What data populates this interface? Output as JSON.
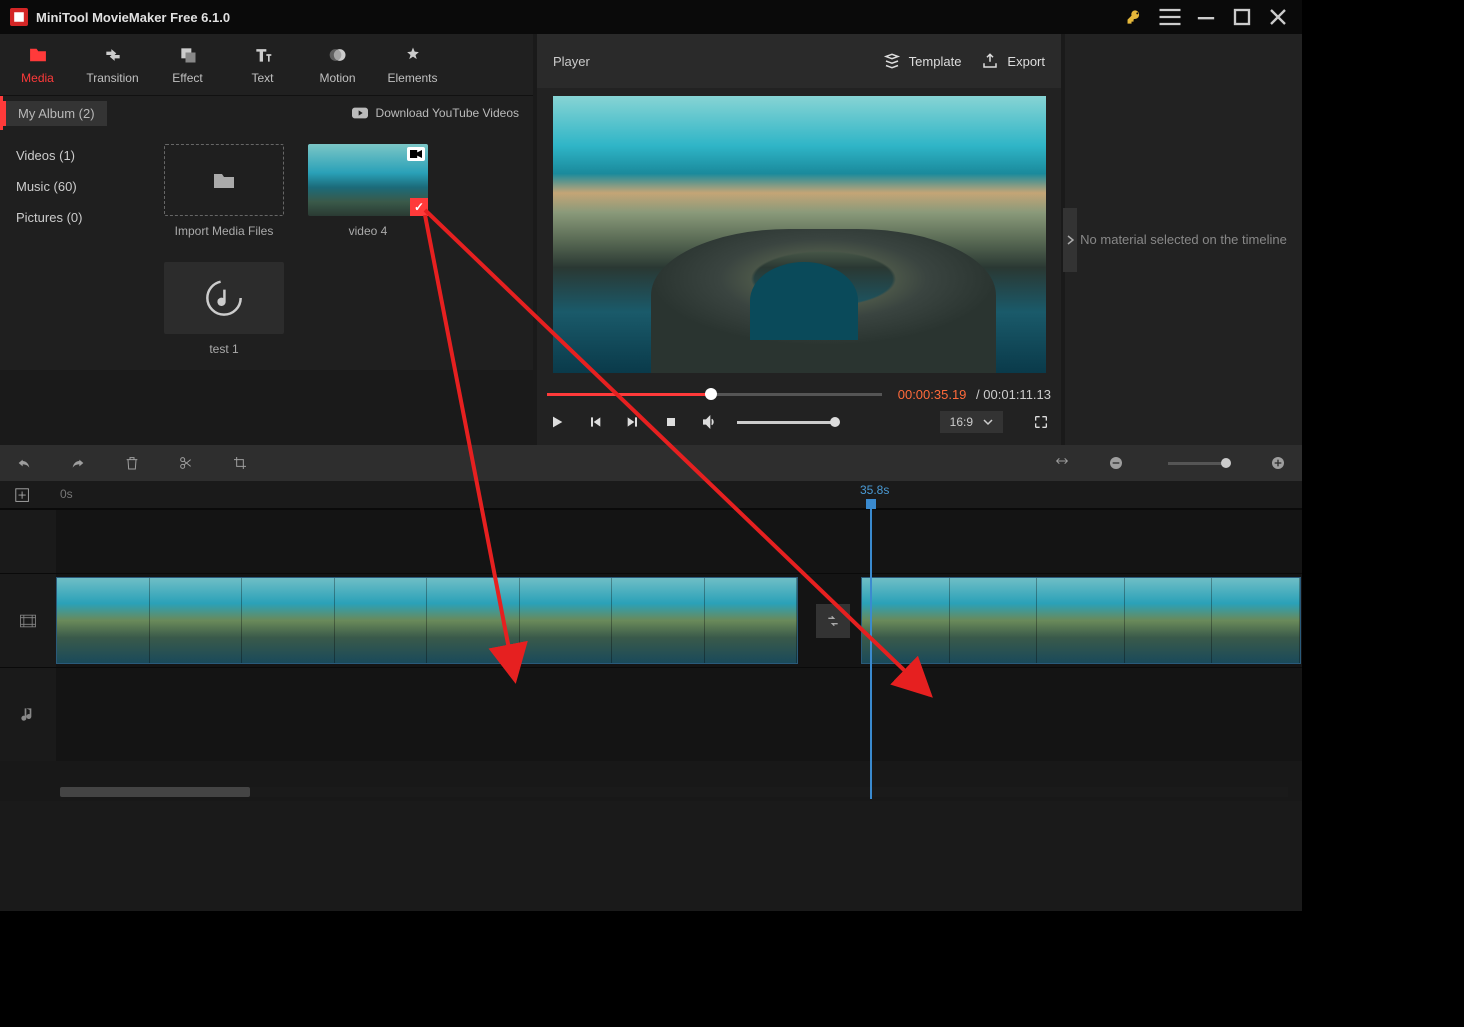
{
  "app": {
    "title": "MiniTool MovieMaker Free 6.1.0"
  },
  "tabs": [
    {
      "key": "media",
      "label": "Media"
    },
    {
      "key": "transition",
      "label": "Transition"
    },
    {
      "key": "effect",
      "label": "Effect"
    },
    {
      "key": "text",
      "label": "Text"
    },
    {
      "key": "motion",
      "label": "Motion"
    },
    {
      "key": "elements",
      "label": "Elements"
    }
  ],
  "album": {
    "header": "My Album (2)",
    "download": "Download YouTube Videos",
    "side": [
      {
        "label": "Videos (1)"
      },
      {
        "label": "Music (60)"
      },
      {
        "label": "Pictures (0)"
      }
    ],
    "items": [
      {
        "kind": "import",
        "label": "Import Media Files"
      },
      {
        "kind": "video",
        "label": "video 4"
      },
      {
        "kind": "music",
        "label": "test 1"
      }
    ]
  },
  "player": {
    "title": "Player",
    "template": "Template",
    "export": "Export",
    "current": "00:00:35.19",
    "duration": "00:01:11.13",
    "ratio": "16:9"
  },
  "props": {
    "empty": "No material selected on the timeline"
  },
  "timeline": {
    "zero_label": "0s",
    "playhead": "35.8s"
  }
}
